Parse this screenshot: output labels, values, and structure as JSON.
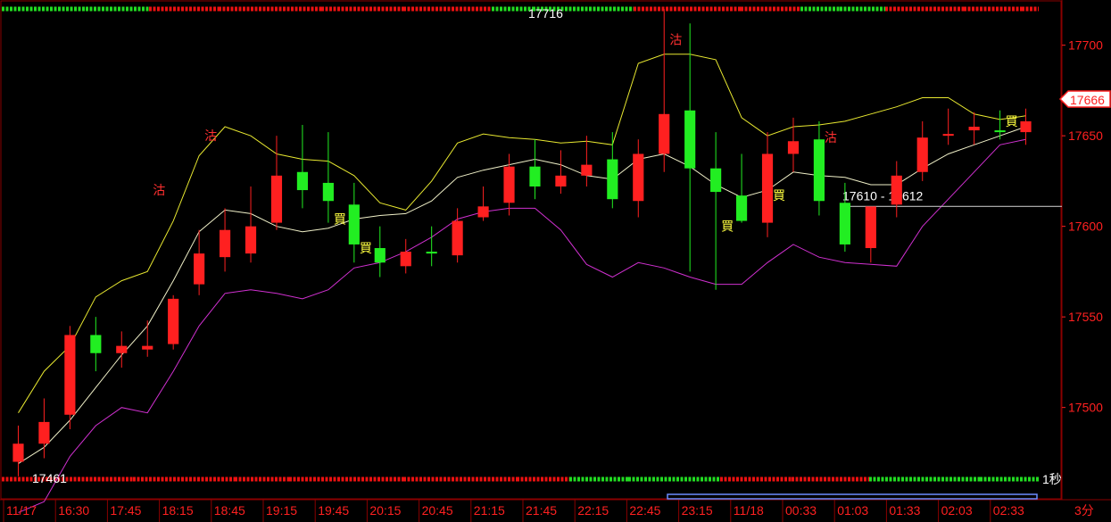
{
  "chart_data": {
    "type": "candlestick",
    "title": "",
    "xlabel": "",
    "ylabel": "",
    "ylim": [
      17455,
      17722
    ],
    "y_ticks": [
      17500,
      17550,
      17600,
      17650,
      17700
    ],
    "x_ticks": [
      "11/17",
      "16:30",
      "17:45",
      "18:15",
      "18:45",
      "19:15",
      "19:45",
      "20:15",
      "20:45",
      "21:15",
      "21:45",
      "22:15",
      "22:45",
      "23:15",
      "11/18",
      "00:33",
      "01:03",
      "01:33",
      "02:03",
      "02:33"
    ],
    "interval_label": "3分",
    "refresh_label": "1秒",
    "last_price": "17666",
    "range_label": "17610 - 17612",
    "range_value": 17611,
    "high_label": "17716",
    "low_label": "17461",
    "grid": false,
    "colors": {
      "background": "#000000",
      "up": "#ff2020",
      "down": "#22ee22",
      "upper_band": "#e8e830",
      "middle_band": "#f0f0c8",
      "lower_band": "#d030d0",
      "range_line": "#bbbbbb",
      "axis_text": "#ff2020",
      "buy_marker": "#ffff40",
      "exit_marker": "#ff3030"
    },
    "series": [
      {
        "name": "",
        "type": "upper_band",
        "values": [
          17497,
          17520,
          17534,
          17561,
          17570,
          17575,
          17603,
          17639,
          17655,
          17650,
          17640,
          17637,
          17636,
          17628,
          17613,
          17609,
          17625,
          17646,
          17651,
          17649,
          17648,
          17646,
          17647,
          17645,
          17690,
          17695,
          17695,
          17692,
          17660,
          17650,
          17655,
          17656,
          17658,
          17662,
          17666,
          17671,
          17671,
          17662,
          17659,
          17661
        ]
      },
      {
        "name": "",
        "type": "middle_band",
        "values": [
          17469,
          17478,
          17493,
          17511,
          17529,
          17545,
          17570,
          17597,
          17609,
          17607,
          17600,
          17597,
          17599,
          17604,
          17606,
          17607,
          17614,
          17627,
          17631,
          17634,
          17637,
          17634,
          17628,
          17626,
          17637,
          17640,
          17633,
          17623,
          17616,
          17620,
          17630,
          17628,
          17627,
          17623,
          17623,
          17632,
          17640,
          17645,
          17650,
          17655
        ]
      },
      {
        "name": "",
        "type": "lower_band",
        "values": [
          17442,
          17448,
          17473,
          17490,
          17500,
          17497,
          17520,
          17545,
          17563,
          17565,
          17563,
          17560,
          17565,
          17577,
          17580,
          17586,
          17594,
          17604,
          17608,
          17610,
          17610,
          17598,
          17579,
          17572,
          17580,
          17577,
          17572,
          17568,
          17568,
          17580,
          17590,
          17583,
          17580,
          17579,
          17578,
          17600,
          17615,
          17630,
          17645,
          17648
        ]
      },
      {
        "name": "",
        "type": "candles",
        "times": [
          "16:00",
          "16:15",
          "16:30",
          "16:45",
          "17:00",
          "17:15",
          "17:30",
          "17:45",
          "18:00",
          "18:15",
          "18:30",
          "18:45",
          "19:00",
          "19:15",
          "19:30",
          "19:45",
          "20:00",
          "20:15",
          "20:30",
          "20:45",
          "21:00",
          "21:15",
          "21:30",
          "21:45",
          "22:00",
          "22:15",
          "22:30",
          "22:45",
          "23:00",
          "23:15",
          "23:30",
          "23:45",
          "00:15",
          "00:33",
          "00:48",
          "01:03",
          "01:18",
          "01:33",
          "01:48",
          "02:03"
        ],
        "open": [
          17470,
          17480,
          17496,
          17540,
          17530,
          17532,
          17535,
          17568,
          17583,
          17585,
          17602,
          17630,
          17624,
          17612,
          17588,
          17578,
          17586,
          17584,
          17605,
          17613,
          17633,
          17622,
          17628,
          17637,
          17614,
          17640,
          17664,
          17632,
          17617,
          17602,
          17640,
          17648,
          17613,
          17588,
          17612,
          17630,
          17650,
          17653,
          17653,
          17652
        ],
        "high": [
          17490,
          17505,
          17545,
          17550,
          17542,
          17548,
          17562,
          17598,
          17610,
          17622,
          17650,
          17656,
          17652,
          17624,
          17600,
          17593,
          17600,
          17610,
          17622,
          17640,
          17648,
          17642,
          17650,
          17652,
          17648,
          17720,
          17712,
          17652,
          17640,
          17652,
          17660,
          17658,
          17624,
          17604,
          17636,
          17658,
          17665,
          17663,
          17664,
          17665
        ],
        "low": [
          17462,
          17472,
          17488,
          17520,
          17522,
          17528,
          17532,
          17562,
          17575,
          17580,
          17598,
          17610,
          17602,
          17580,
          17572,
          17574,
          17578,
          17580,
          17603,
          17606,
          17615,
          17618,
          17622,
          17610,
          17605,
          17630,
          17575,
          17565,
          17602,
          17594,
          17630,
          17606,
          17586,
          17580,
          17605,
          17625,
          17645,
          17645,
          17648,
          17645
        ],
        "close": [
          17480,
          17492,
          17540,
          17530,
          17534,
          17534,
          17560,
          17585,
          17598,
          17600,
          17628,
          17620,
          17614,
          17590,
          17580,
          17586,
          17585,
          17603,
          17611,
          17633,
          17622,
          17628,
          17634,
          17615,
          17640,
          17662,
          17632,
          17619,
          17603,
          17640,
          17647,
          17614,
          17590,
          17611,
          17628,
          17649,
          17651,
          17655,
          17652,
          17658
        ]
      }
    ],
    "signals": [
      {
        "label": "沽",
        "price": 17620
      },
      {
        "label": "買",
        "price": 17588
      },
      {
        "label": "沽",
        "price": 17650
      },
      {
        "label": "買",
        "price": 17617
      },
      {
        "label": "沽",
        "price": 17703
      },
      {
        "label": "買",
        "price": 17604
      },
      {
        "label": "沽",
        "price": 17649
      },
      {
        "label": "買",
        "price": 17600
      },
      {
        "label": "買",
        "price": 17658
      }
    ]
  }
}
